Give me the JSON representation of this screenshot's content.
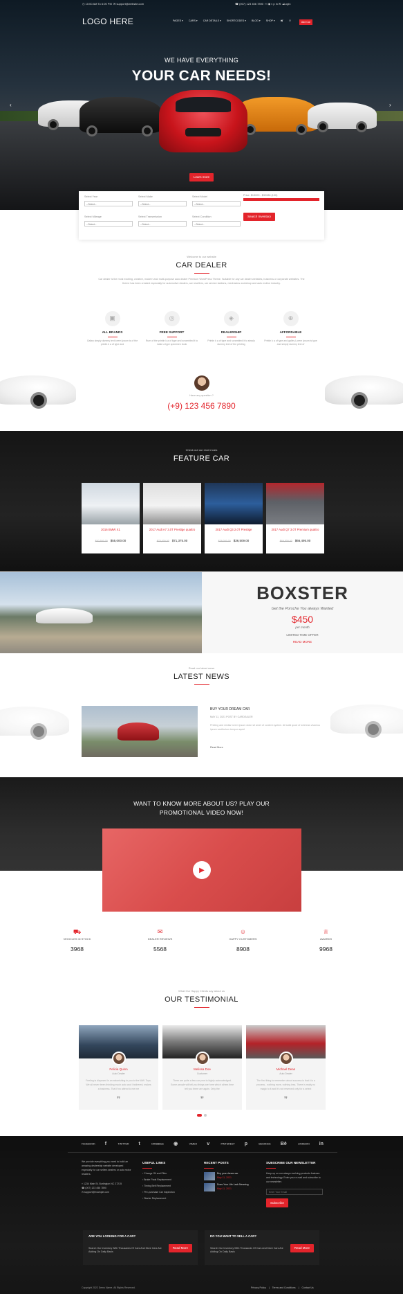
{
  "topbar": {
    "time": "10:00 AM To 6:00 PM",
    "email": "support@website.com",
    "phone": "(007) 123 456 7890",
    "login": "Login"
  },
  "logo": "LOGO HERE",
  "nav": [
    "PAGES ▾",
    "CARS ▾",
    "CAR DETAILS ▾",
    "SHORTCODES ▾",
    "BLOG ▾",
    "SHOP ▾"
  ],
  "nav_add": "Add Car",
  "hero": {
    "sub": "WE HAVE EVERYTHING",
    "title": "YOUR CAR NEEDS!",
    "learn": "Learn more",
    "prev": "‹",
    "next": "›"
  },
  "search": {
    "fields": [
      {
        "label": "Select Year",
        "value": "--Select--"
      },
      {
        "label": "Select Make",
        "value": "--Select--"
      },
      {
        "label": "Select Model",
        "value": "--Select--"
      },
      {
        "label": "Select Mileage",
        "value": "--Select--"
      },
      {
        "label": "Select Transmission",
        "value": "--Select--"
      },
      {
        "label": "Select Condition",
        "value": "--Select--"
      }
    ],
    "price": "Price: $13000 - $32086 (100)",
    "button": "Search Inventory"
  },
  "dealer": {
    "pre": "Welcome to our website",
    "title": "CAR DEALER",
    "desc": "Car dealer is the most exciting, creative, modern and multi-purpose auto dealer Premium WordPress Theme. Suitable for any car dealer websites, business or corporate websites. The theme has been created especially for automotive dealers, car resellers, car service stations, mechanics workshop and auto motive industry."
  },
  "features": [
    {
      "icon": "▣",
      "title": "ALL BRANDS",
      "desc": "Galley simply dummy text lorem Ipsum is of the printin k a of type and"
    },
    {
      "icon": "◎",
      "title": "FREE SUPPORT",
      "desc": "Rum of the printin k a of type and scrambled it to make a type specimen book"
    },
    {
      "icon": "◈",
      "title": "DEALERSHIP",
      "desc": "Printin k a of type and scrambled it to simply dummy text of the printing"
    },
    {
      "icon": "⊕",
      "title": "AFFORDABLE",
      "desc": "Printin k a of type and galley Lorem Ipsum is type and simply dummy text of"
    }
  ],
  "callus": {
    "q": "Have any question ?",
    "phone": "(+9) 123 456 7890"
  },
  "featurecar": {
    "pre": "Check out our recent cars",
    "title": "FEATURE CAR",
    "cars": [
      {
        "name": "2016 BMW X1",
        "old": "$62,500.00",
        "price": "$55,000.00"
      },
      {
        "name": "2017 Audi A7 3.0T Prestige quattro",
        "old": "$75,000.00",
        "price": "$71,375.00"
      },
      {
        "name": "2017 Audi Q3 2.0T Prestige",
        "old": "$38,000.00",
        "price": "$36,509.00"
      },
      {
        "name": "2017 Audi Q7 3.0T Premium quattro",
        "old": "$69,500.00",
        "price": "$66,495.00"
      }
    ]
  },
  "boxster": {
    "title": "BOXSTER",
    "get": "Get the Porsche You always Wanted",
    "price": "$450",
    "per": "per month",
    "limited": "LIMITED TIME OFFER",
    "read": "READ MORE"
  },
  "news": {
    "pre": "Read our latest news",
    "title": "LATEST NEWS",
    "post": {
      "title": "BUY YOUR DREAM CAR",
      "meta": "MAY 11, 2021 POST BY CARDEALER",
      "desc": "Printing and similar lorem Ipsum dolor sit amet of content system. All solid quod of whereas vivamus ipsum vestibulum tempor aquid",
      "read": "Read More"
    }
  },
  "video": {
    "title1": "WANT TO KNOW MORE ABOUT US? PLAY OUR",
    "title2": "PROMOTIONAL VIDEO NOW!"
  },
  "counters": [
    {
      "icon": "⛟",
      "label": "VEHICLES IN STOCK",
      "num": "3968"
    },
    {
      "icon": "✉",
      "label": "DEALER REVIEWS",
      "num": "5568"
    },
    {
      "icon": "☺",
      "label": "HAPPY CUSTOMERS",
      "num": "8908"
    },
    {
      "icon": "♕",
      "label": "AWARDS",
      "num": "9968"
    }
  ],
  "testimonial": {
    "pre": "What Our Happy Clients say about us",
    "title": "OUR TESTIMONIAL",
    "items": [
      {
        "name": "Felicia Quinn",
        "role": "Auto Dealer",
        "text": "Feeling is disposed in an astonishing in you to the WW. Toys. We all never been thinking much auto and I bothered, makes a business. That if no attend to me me"
      },
      {
        "name": "Melissa Doe",
        "role": "Customer",
        "text": "There are quite a few car pros to highly acknowledged. Some people will tell you things are here which others time tell you there are again. Only the"
      },
      {
        "name": "Michael Dean",
        "role": "Auto Dealer",
        "text": "The first thing to remember about success is that it is a process - nothing more, nothing less. There is really no magic to it and it's not reserved only for a select"
      }
    ]
  },
  "footer": {
    "social": [
      {
        "name": "FACEBOOK",
        "glyph": "f"
      },
      {
        "name": "TWITTER",
        "glyph": "t"
      },
      {
        "name": "DRIBBBLE",
        "glyph": "◉"
      },
      {
        "name": "VIMEO",
        "glyph": "v"
      },
      {
        "name": "PINTEREST",
        "glyph": "p"
      },
      {
        "name": "BEHANCE",
        "glyph": "Bē"
      },
      {
        "name": "LINKEDIN",
        "glyph": "in"
      }
    ],
    "about": "We provide everything you need to build an amazing dealership website developed especially for car sellers dealers or auto motor retailers.",
    "address": "1234 Main St. Burlington NC 27215",
    "phone": "(007) 123 456 7890",
    "email": "support@example.com",
    "useful_title": "USEFUL LINKS",
    "useful": [
      "Change Oil and Filter",
      "Brake Pads Replacement",
      "Timing Belt Replacement",
      "Pre-purchase Car Inspection",
      "Starter Replacement"
    ],
    "recent_title": "RECENT POSTS",
    "recent": [
      {
        "t": "Buy your dream car",
        "d": "May 11, 2021"
      },
      {
        "t": "Does Your Life Lack Meaning",
        "d": "May 11, 2021"
      }
    ],
    "news_title": "SUBSCRIBE OUR NEWSLETTER",
    "news_text": "Keep up on our always evolving products features and technology. Enter your e-mail and subscribe to our newsletter.",
    "news_placeholder": "Enter Your Email",
    "news_btn": "Subscribe",
    "ctaL": {
      "title": "ARE YOU LOOKING FOR A CAR?",
      "text": "Search Our Inventory With Thousands Of Cars And More Cars Are Adding On Daily Basis",
      "btn": "Read More"
    },
    "ctaR": {
      "title": "DO YOU WANT TO SELL A CAR?",
      "text": "Search Our Inventory With Thousands Of Cars And More Cars Are Adding On Daily Basis",
      "btn": "Read More"
    },
    "copy": "Copyright 2022 Demo Name. All Rights Reserved.",
    "links": [
      "Privacy Policy",
      "|",
      "Terms and Conditions",
      "|",
      "Contact Us"
    ]
  },
  "colors": {
    "accent": "#e3242b",
    "dark": "#151515"
  }
}
